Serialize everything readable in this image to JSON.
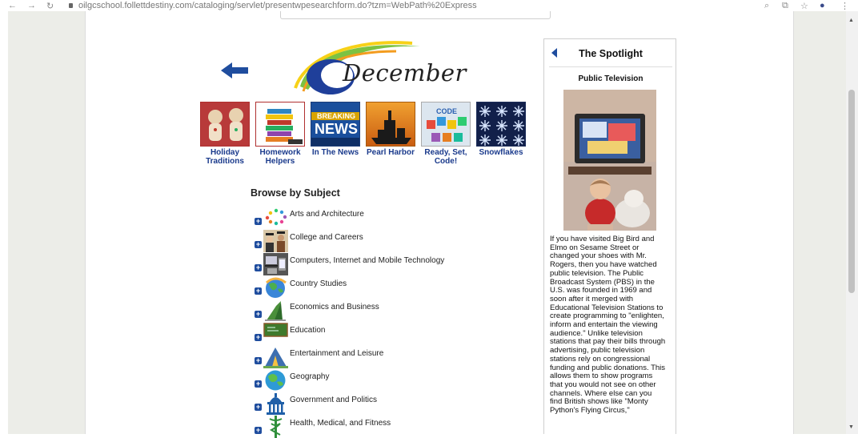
{
  "browser": {
    "url": "oilgcschool.follettdestiny.com/cataloging/servlet/presentwpesearchform.do?tzm=WebPath%20Express"
  },
  "page": {
    "banner_title": "December",
    "tiles": [
      {
        "label": "Holiday Traditions",
        "icon": "gingerbread-image"
      },
      {
        "label": "Homework Helpers",
        "icon": "books-image"
      },
      {
        "label": "In The News",
        "icon": "breaking-news-image",
        "badge_top": "BREAKING",
        "badge_bottom": "NEWS"
      },
      {
        "label": "Pearl Harbor",
        "icon": "battleship-image"
      },
      {
        "label": "Ready, Set, Code!",
        "icon": "code-blocks-image",
        "badge": "CODE"
      },
      {
        "label": "Snowflakes",
        "icon": "snowflakes-image"
      }
    ],
    "browse_heading": "Browse by Subject",
    "subjects": [
      {
        "label": "Arts and Architecture",
        "icon": "paint-palette-icon"
      },
      {
        "label": "College and Careers",
        "icon": "graduates-icon"
      },
      {
        "label": "Computers, Internet and Mobile Technology",
        "icon": "devices-icon"
      },
      {
        "label": "Country Studies",
        "icon": "globe-flags-icon"
      },
      {
        "label": "Economics and Business",
        "icon": "growth-chart-icon"
      },
      {
        "label": "Education",
        "icon": "chalkboard-icon"
      },
      {
        "label": "Entertainment and Leisure",
        "icon": "tent-icon"
      },
      {
        "label": "Geography",
        "icon": "earth-icon"
      },
      {
        "label": "Government and Politics",
        "icon": "capitol-icon"
      },
      {
        "label": "Health, Medical, and Fitness",
        "icon": "caduceus-icon"
      }
    ]
  },
  "spotlight": {
    "title": "The Spotlight",
    "subtitle": "Public Television",
    "body_lines": [
      "If you have visited Big Bird and",
      "Elmo on Sesame Street or",
      "changed your shoes with Mr.",
      "Rogers, then you have watched",
      "public television. The Public",
      "Broadcast System (PBS) in the",
      "U.S. was founded in 1969 and",
      "soon after it merged with",
      "Educational Television Stations to",
      "create programming to \"enlighten,",
      "inform and entertain the viewing",
      "audience.\" Unlike television",
      "stations that pay their bills through",
      "advertising, public television",
      "stations rely on congressional",
      "funding and public donations. This",
      "allows them to show programs",
      "that you would not see on other",
      "channels. Where else can you",
      "find British shows like \"Monty",
      "Python's Flying Circus,\""
    ]
  },
  "colors": {
    "link": "#1a3a8c",
    "accent": "#1f4d9e",
    "gutter": "#ecede8"
  }
}
